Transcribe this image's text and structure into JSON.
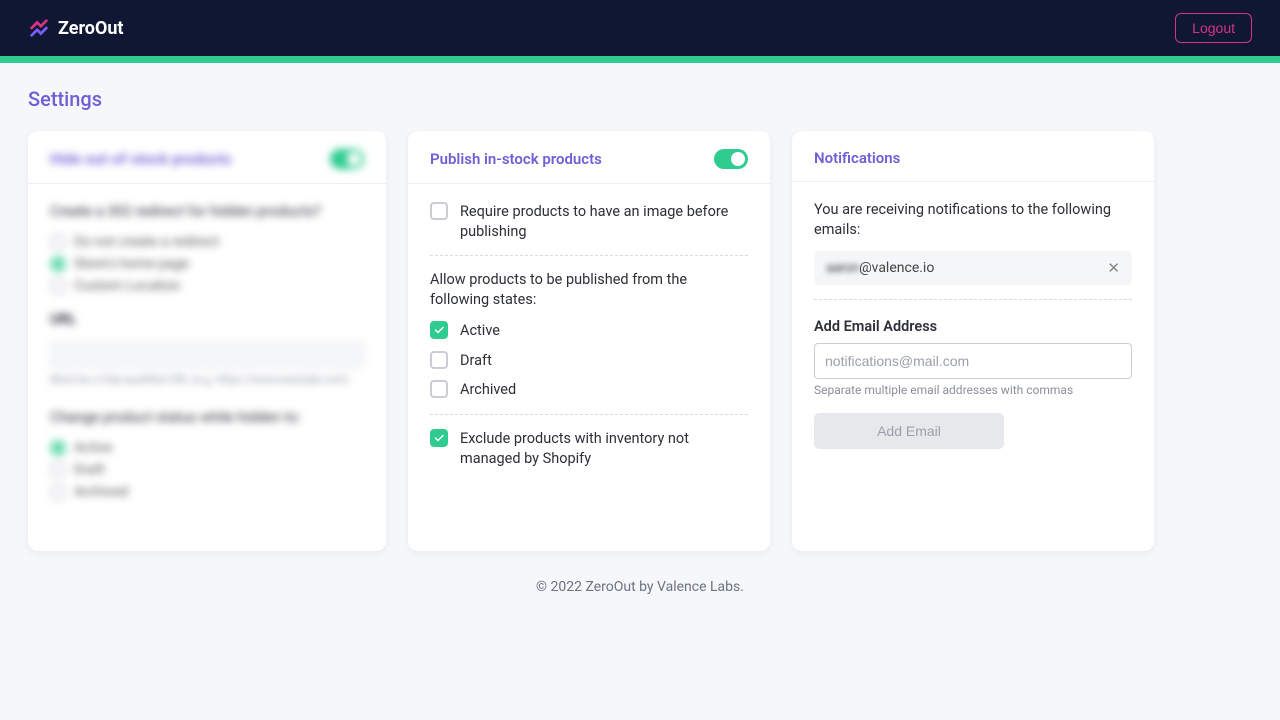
{
  "brand": {
    "name": "ZeroOut"
  },
  "topbar": {
    "logout": "Logout"
  },
  "page": {
    "title": "Settings"
  },
  "card_hide": {
    "title": "Hide out-of-stock products",
    "redirect_q": "Create a 302 redirect for hidden products?",
    "opt_none": "Do not create a redirect",
    "opt_home": "Store's home page",
    "opt_custom": "Custom Location",
    "url_label": "URL",
    "url_help": "Must be a fully-qualified URL (e.g. https://www.example.com)",
    "status_label": "Change product status while hidden to:",
    "status_active": "Active",
    "status_draft": "Draft",
    "status_archived": "Archived"
  },
  "card_publish": {
    "title": "Publish in-stock products",
    "require_image": "Require products to have an image before publishing",
    "states_label": "Allow products to be published from the following states:",
    "state_active": "Active",
    "state_draft": "Draft",
    "state_archived": "Archived",
    "exclude_unmanaged": "Exclude products with inventory not managed by Shopify"
  },
  "card_notif": {
    "title": "Notifications",
    "intro": "You are receiving notifications to the following emails:",
    "email_hidden_part": "aaron",
    "email_visible_part": "@valence.io",
    "add_label": "Add Email Address",
    "placeholder": "notifications@mail.com",
    "help": "Separate multiple email addresses with commas",
    "add_btn": "Add Email"
  },
  "footer": {
    "text": "© 2022 ZeroOut by Valence Labs."
  }
}
